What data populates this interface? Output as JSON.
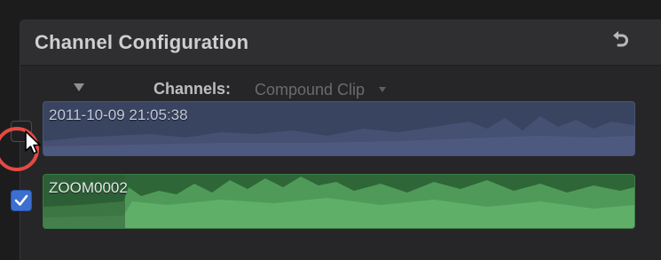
{
  "panel": {
    "title": "Channel Configuration",
    "reset_icon": "reset-arrow-icon"
  },
  "channels": {
    "label": "Channels:",
    "selected": "Compound Clip",
    "disclosure_icon": "disclosure-triangle-icon",
    "dropdown_icon": "dropdown-arrow-icon"
  },
  "clips": [
    {
      "name": "2011-10-09 21:05:38",
      "checked": false,
      "color": "#394461"
    },
    {
      "name": "ZOOM0002",
      "checked": true,
      "color": "#2e6638"
    }
  ],
  "colors": {
    "highlight_ring": "#e44a44",
    "checkbox_checked": "#3c6fcf"
  }
}
